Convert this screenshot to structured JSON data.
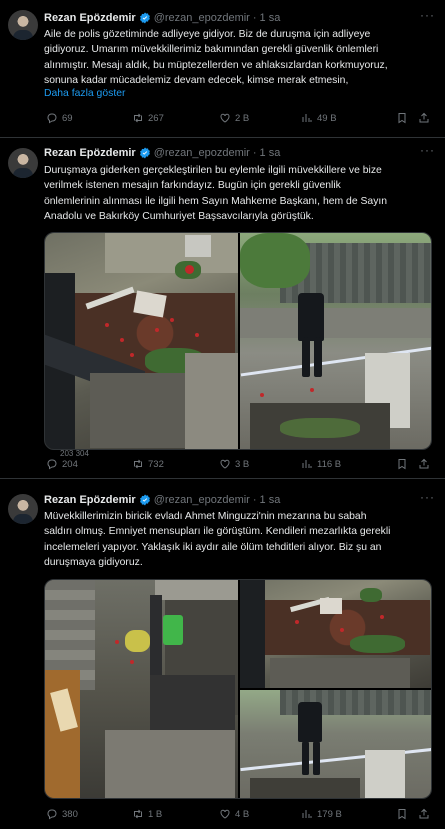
{
  "author": {
    "name": "Rezan Epözdemir",
    "handle": "@rezan_epozdemir",
    "verified_color": "#1d9bf0"
  },
  "tweets": [
    {
      "time": "1 sa",
      "text": "Aile de polis gözetiminde adliyeye gidiyor. Biz de duruşma için adliyeye\ngidiyoruz. Umarım müvekkillerimiz bakımından gerekli güvenlik önlemleri\nalınmıştır. Mesajı aldık, bu müptezellerden ve ahlaksızlardan korkmuyoruz,\nsonuna kadar mücadelemiz devam edecek, kimse merak etmesin,",
      "show_more": "Daha fazla göster",
      "replies": "69",
      "retweets": "267",
      "likes": "2 B",
      "views": "49 B"
    },
    {
      "time": "1 sa",
      "text": "Duruşmaya giderken gerçekleştirilen bu eylemle ilgili müvekkillere ve bize\nverilmek istenen mesajın farkındayız. Bugün için gerekli güvenlik\nönlemlerinin alınması ile ilgili hem Sayın Mahkeme Başkanı, hem de Sayın\nAnadolu ve Bakırköy Cumhuriyet Başsavcılarıyla görüştük.",
      "overlay_views": "203 304",
      "replies": "204",
      "retweets": "732",
      "likes": "3 B",
      "views": "116 B"
    },
    {
      "time": "1 sa",
      "text": "Müvekkillerimizin biricik evladı Ahmet Minguzzi'nin mezarına bu sabah\nsaldırı olmuş. Emniyet mensupları ile görüştüm. Kendileri mezarlıkta gerekli\nincelemeleri yapıyor. Yaklaşık iki aydır aile ölüm tehditleri alıyor. Biz şu an\nduruşmaya gidiyoruz.",
      "replies": "380",
      "retweets": "1 B",
      "likes": "4 B",
      "views": "179 B"
    }
  ]
}
